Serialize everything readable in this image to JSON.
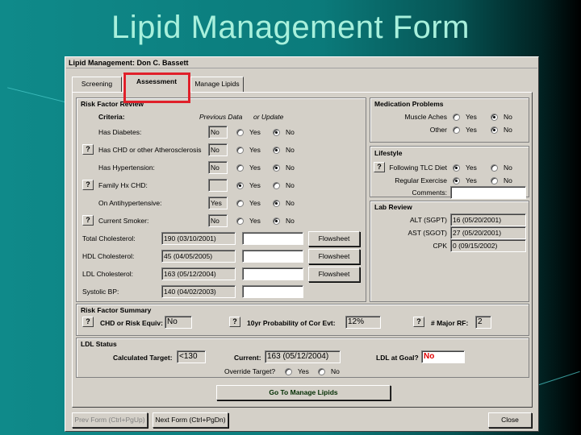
{
  "slide": {
    "title": "Lipid Management Form"
  },
  "window": {
    "title": "Lipid Management:  Don C. Bassett"
  },
  "tabs": [
    {
      "label": "Screening"
    },
    {
      "label": "Assessment"
    },
    {
      "label": "Manage Lipids"
    }
  ],
  "risk_factor_review": {
    "title": "Risk Factor Review",
    "criteria_label": "Criteria:",
    "previous_data_label": "Previous Data",
    "or_update_label": "or Update",
    "yes_label": "Yes",
    "no_label": "No",
    "rows": [
      {
        "label": "Has Diabetes:",
        "value": "No",
        "selected": "no"
      },
      {
        "label": "Has CHD or other Atherosclerosis",
        "value": "No",
        "selected": "no"
      },
      {
        "label": "Has Hypertension:",
        "value": "No",
        "selected": "no"
      },
      {
        "label": "Family Hx CHD:",
        "value": "",
        "selected": "yes"
      },
      {
        "label": "On Antihypertensive:",
        "value": "Yes",
        "selected": "no"
      },
      {
        "label": "Current Smoker:",
        "value": "No",
        "selected": "no"
      }
    ],
    "labs": [
      {
        "label": "Total Cholesterol:",
        "value": "190 (03/10/2001)",
        "button": "Flowsheet"
      },
      {
        "label": "HDL Cholesterol:",
        "value": "45 (04/05/2005)",
        "button": "Flowsheet"
      },
      {
        "label": "LDL Cholesterol:",
        "value": "163 (05/12/2004)",
        "button": "Flowsheet"
      },
      {
        "label": "Systolic BP:",
        "value": "140 (04/02/2003)"
      }
    ]
  },
  "medication_problems": {
    "title": "Medication Problems",
    "rows": [
      {
        "label": "Muscle Aches",
        "selected": "no"
      },
      {
        "label": "Other",
        "selected": "no"
      }
    ]
  },
  "lifestyle": {
    "title": "Lifestyle",
    "rows": [
      {
        "label": "Following TLC Diet",
        "selected": "yes"
      },
      {
        "label": "Regular Exercise",
        "selected": "yes"
      }
    ],
    "comments_label": "Comments:",
    "comments_value": ""
  },
  "lab_review": {
    "title": "Lab Review",
    "rows": [
      {
        "label": "ALT (SGPT)",
        "value": "16 (05/20/2001)"
      },
      {
        "label": "AST (SGOT)",
        "value": "27 (05/20/2001)"
      },
      {
        "label": "CPK",
        "value": "0 (09/15/2002)"
      }
    ]
  },
  "risk_factor_summary": {
    "title": "Risk Factor Summary",
    "chd_label": "CHD or Risk Equiv:",
    "chd_value": "No",
    "prob_label": "10yr Probability of Cor Evt:",
    "prob_value": "12%",
    "major_label": "# Major RF:",
    "major_value": "2",
    "help": "?"
  },
  "ldl_status": {
    "title": "LDL Status",
    "calc_label": "Calculated Target:",
    "calc_value": "<130",
    "current_label": "Current:",
    "current_value": "163 (05/12/2004)",
    "goal_label": "LDL at Goal?",
    "goal_value": "No",
    "override_label": "Override Target?",
    "yes_label": "Yes",
    "no_label": "No"
  },
  "buttons": {
    "go_manage": "Go To Manage Lipids",
    "prev": "Prev Form (Ctrl+PgUp)",
    "next": "Next Form (Ctrl+PgDn)",
    "close": "Close"
  },
  "help": "?"
}
